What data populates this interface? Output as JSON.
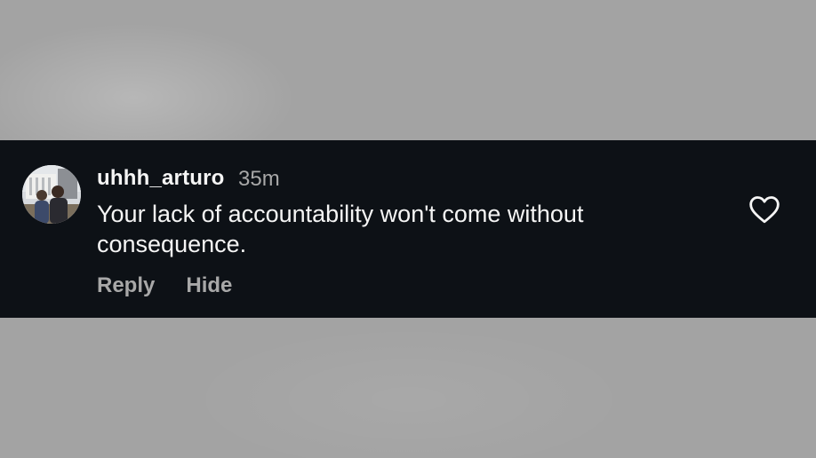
{
  "comment": {
    "username": "uhhh_arturo",
    "timestamp": "35m",
    "text": "Your lack of accountability won't come without consequence.",
    "actions": {
      "reply_label": "Reply",
      "hide_label": "Hide"
    },
    "liked": false
  },
  "icons": {
    "like": "heart-outline-icon"
  },
  "colors": {
    "card_background": "#0d1116",
    "backdrop": "#a3a3a3",
    "primary_text": "#f5f5f5",
    "secondary_text": "#a8a8a8"
  }
}
